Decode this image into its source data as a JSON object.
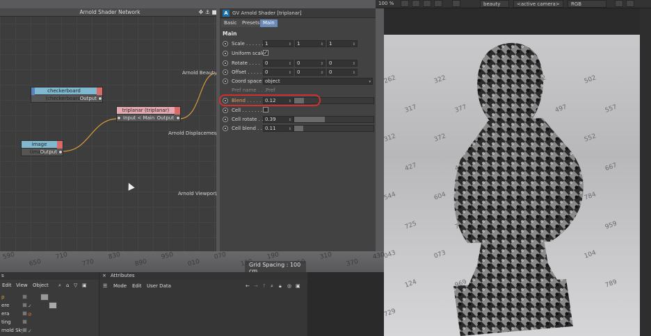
{
  "toolbar": {
    "zoom": "100 %",
    "pass": "beauty",
    "camera": "<active camera>",
    "colorspace": "RGB"
  },
  "node_editor": {
    "title": "Arnold Shader Network",
    "nodes": {
      "checkerboard": {
        "title": "checkerboard (checkerboard)",
        "out": "Output"
      },
      "triplanar": {
        "title": "triplanar (triplanar)",
        "in": "Input < Main",
        "out": "Output"
      },
      "image": {
        "title": "image (image)",
        "out": "Output"
      }
    },
    "outputs": {
      "beauty": "Arnold Beauty",
      "displacement": "Arnold Displacement",
      "viewport": "Arnold Viewport"
    },
    "grid_spacing": "Grid Spacing : 100 cm"
  },
  "shader": {
    "title": "GV Arnold Shader [triplanar]",
    "tabs": [
      "Basic",
      "Presets",
      "Main"
    ],
    "active_tab": "Main",
    "section": "Main",
    "scale": {
      "label": "Scale . . . . . .",
      "x": "1",
      "y": "1",
      "z": "1"
    },
    "uniform_scale": {
      "label": "Uniform scale",
      "checked": true
    },
    "rotate": {
      "label": "Rotate . . . .",
      "x": "0",
      "y": "0",
      "z": "0"
    },
    "offset": {
      "label": "Offset . . . . .",
      "x": "0",
      "y": "0",
      "z": "0"
    },
    "coord_space": {
      "label": "Coord space",
      "value": "object"
    },
    "pref_name": {
      "label": "Pref name . . .",
      "value": "Pref"
    },
    "blend": {
      "label": "Blend . . . . . .",
      "value": "0.12",
      "fraction": 0.12
    },
    "cell": {
      "label": "Cell . . . . . . .",
      "checked": false
    },
    "cell_rotate": {
      "label": "Cell rotate . .",
      "value": "0.39",
      "fraction": 0.39
    },
    "cell_blend": {
      "label": "Cell blend . . .",
      "value": "0.11",
      "fraction": 0.11
    }
  },
  "object_manager": {
    "menu": [
      "Edit",
      "View",
      "Object"
    ],
    "rows": [
      "p",
      "ere",
      "era",
      "ting",
      "rnold Sky"
    ]
  },
  "attributes": {
    "title": "Attributes",
    "menu": [
      "Mode",
      "Edit",
      "User Data"
    ]
  },
  "viewport_numbers": [
    "590",
    "650",
    "710",
    "770",
    "830",
    "890",
    "950",
    "010",
    "070",
    "130",
    "190",
    "250",
    "310",
    "370",
    "430"
  ],
  "render_numbers": [
    "262",
    "322",
    "382",
    "442",
    "502",
    "317",
    "377",
    "437",
    "497",
    "557",
    "312",
    "372",
    "432",
    "492",
    "552",
    "427",
    "487",
    "547",
    "607",
    "667",
    "544",
    "604",
    "664",
    "724",
    "784",
    "725",
    "779",
    "839",
    "899",
    "959",
    "043",
    "073",
    "103",
    "133",
    "104",
    "124",
    "969",
    "909",
    "849",
    "789",
    "729"
  ]
}
